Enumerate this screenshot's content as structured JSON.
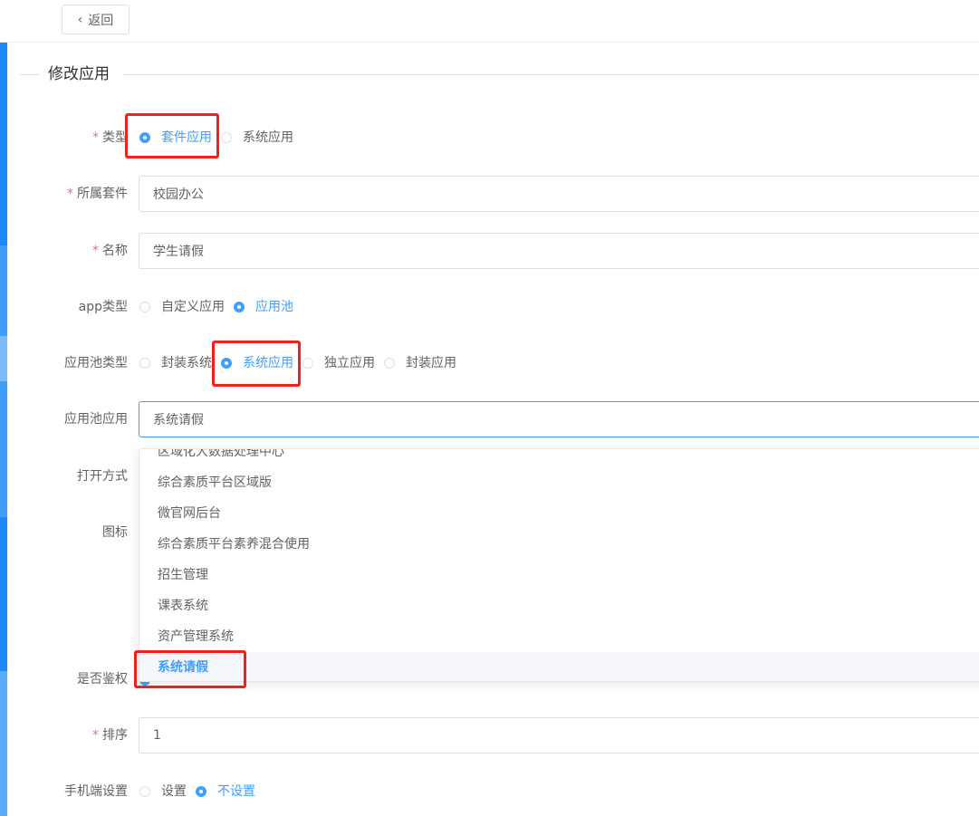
{
  "topbar": {
    "back_label": "返回"
  },
  "section": {
    "title": "修改应用"
  },
  "form": {
    "type": {
      "label": "类型",
      "options": [
        "套件应用",
        "系统应用"
      ],
      "selected": "套件应用"
    },
    "suite": {
      "label": "所属套件",
      "value": "校园办公"
    },
    "name": {
      "label": "名称",
      "value": "学生请假"
    },
    "app_type": {
      "label": "app类型",
      "options": [
        "自定义应用",
        "应用池"
      ],
      "selected": "应用池"
    },
    "pool_type": {
      "label": "应用池类型",
      "options": [
        "封装系统",
        "系统应用",
        "独立应用",
        "封装应用"
      ],
      "selected": "系统应用"
    },
    "pool_app": {
      "label": "应用池应用",
      "value": "系统请假"
    },
    "open_mode": {
      "label": "打开方式"
    },
    "icon": {
      "label": "图标"
    },
    "auth": {
      "label": "是否鉴权"
    },
    "order": {
      "label": "排序",
      "value": "1"
    },
    "mobile": {
      "label": "手机端设置",
      "options": [
        "设置",
        "不设置"
      ],
      "selected": "不设置"
    }
  },
  "dropdown": {
    "items": [
      "区域化大数据处理中心",
      "综合素质平台区域版",
      "微官网后台",
      "综合素质平台素养混合使用",
      "招生管理",
      "课表系统",
      "资产管理系统",
      "系统请假"
    ],
    "selected": "系统请假"
  },
  "colors": {
    "accent": "#409eff",
    "required": "#f56c6c",
    "highlight": "#f0211b",
    "sidebar": "#1890ff"
  }
}
